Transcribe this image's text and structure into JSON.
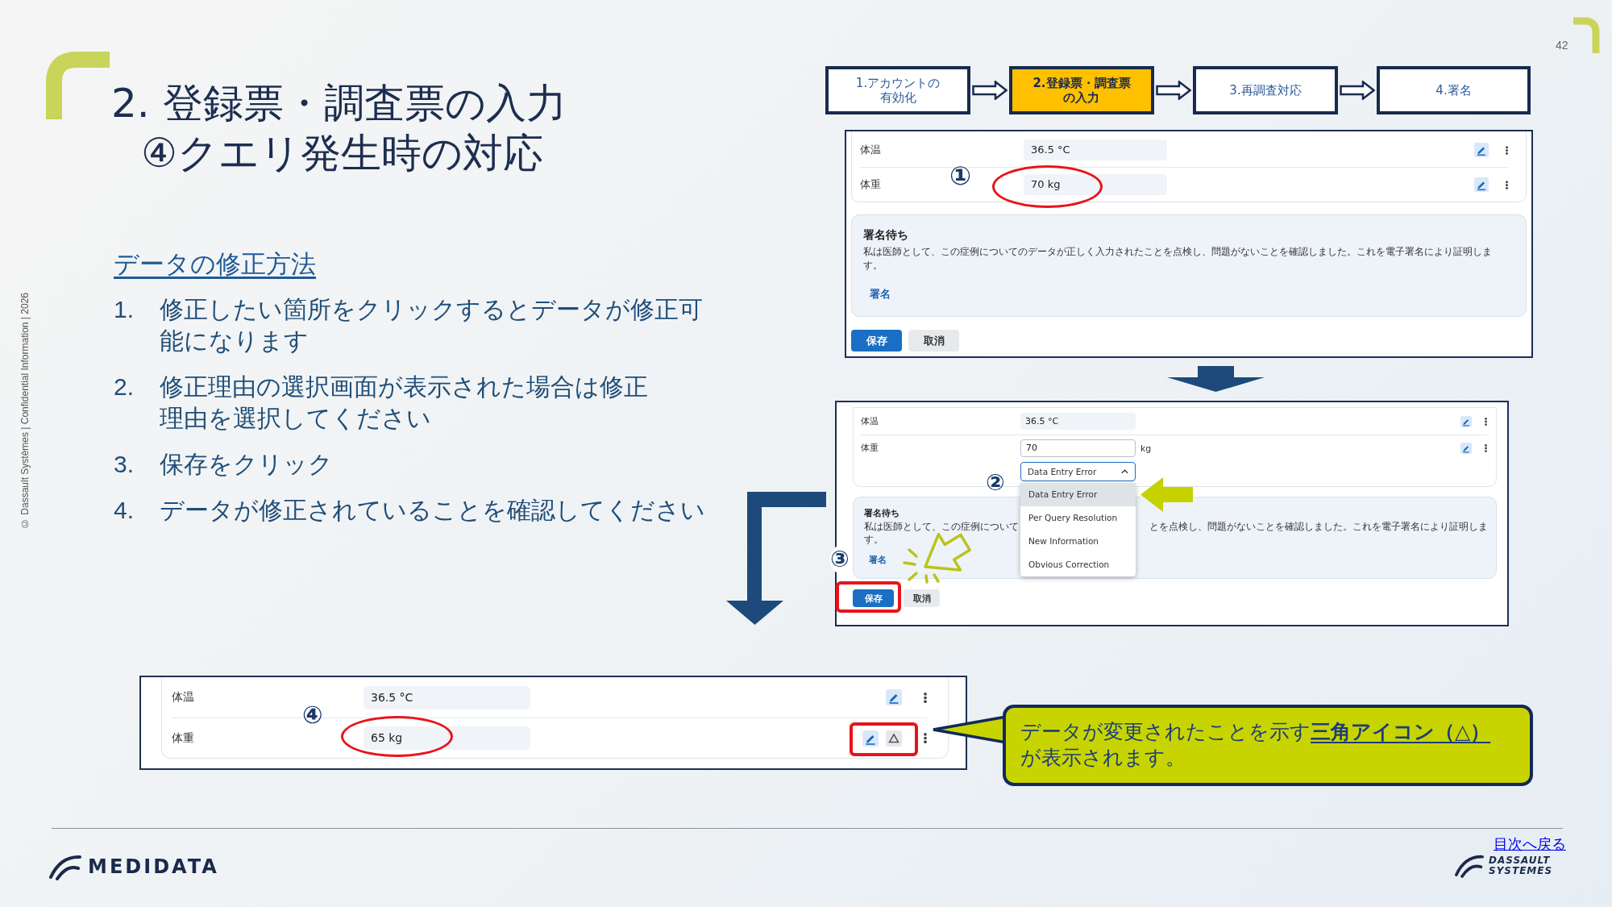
{
  "page_number": "42",
  "title": "2. 登録票・調査票の入力",
  "subtitle": "④クエリ発生時の対応",
  "side_note": "© Dassault Systèmes | Confidential Information | 2026",
  "flow_steps": [
    {
      "lines": [
        "1.アカウントの",
        "有効化"
      ],
      "selected": false
    },
    {
      "lines": [
        "2.登録票・調査票",
        "の入力"
      ],
      "selected": true
    },
    {
      "lines": [
        "3.再調査対応"
      ],
      "selected": false
    },
    {
      "lines": [
        "4.署名"
      ],
      "selected": false
    }
  ],
  "instructions": {
    "heading": "データの修正方法",
    "items": [
      {
        "number": "1.",
        "lines": [
          "修正したい箇所をクリックするとデータが修正可",
          "能になります"
        ]
      },
      {
        "number": "2.",
        "lines": [
          "修正理由の選択画面が表示された場合は修正",
          "理由を選択してください"
        ]
      },
      {
        "number": "3.",
        "lines": [
          "保存をクリック"
        ]
      },
      {
        "number": "4.",
        "lines": [
          "データが修正されていることを確認してください"
        ]
      }
    ]
  },
  "screenshot_before": {
    "marker": "①",
    "rows": [
      {
        "label": "体温",
        "value": "36.5 °C",
        "highlighted": false
      },
      {
        "label": "体重",
        "value": "70 kg",
        "highlighted": true
      }
    ],
    "signature": {
      "heading": "署名待ち",
      "text": "私は医師として、この症例についてのデータが正しく入力されたことを点検し、問題がないことを確認しました。これを電子署名により証明します。",
      "link": "署名"
    },
    "buttons": [
      {
        "label": "保存",
        "kind": "primary",
        "highlighted": false
      },
      {
        "label": "取消",
        "kind": "secondary",
        "highlighted": false
      }
    ]
  },
  "screenshot_editing": {
    "rows": [
      {
        "kind": "readonly",
        "label": "体温",
        "value": "36.5 °C"
      },
      {
        "kind": "editing",
        "label": "体重",
        "value": "70",
        "unit": "kg",
        "reason": {
          "value": "Data Entry Error",
          "expanded": true,
          "marker": "②",
          "options": [
            {
              "label": "Data Entry Error",
              "selected": true
            },
            {
              "label": "Per Query Resolution",
              "selected": false
            },
            {
              "label": "New Information",
              "selected": false
            },
            {
              "label": "Obvious Correction",
              "selected": false
            }
          ]
        }
      }
    ],
    "signature": {
      "heading": "署名待ち",
      "text_left": "私は医師として、この症例について",
      "text_right": "とを点検し、問題がないことを確認しました。これを電子署名により証明しま",
      "text_end": "す。",
      "link": "署名"
    },
    "save_marker": "③",
    "buttons": [
      {
        "label": "保存",
        "kind": "primary",
        "highlighted": true
      },
      {
        "label": "取消",
        "kind": "secondary",
        "highlighted": false
      }
    ]
  },
  "screenshot_after": {
    "marker": "④",
    "rows": [
      {
        "label": "体温",
        "value": "36.5 °C",
        "highlighted": false,
        "changed": false
      },
      {
        "label": "体重",
        "value": "65 kg",
        "highlighted": true,
        "changed": true
      }
    ]
  },
  "callout": {
    "lines": [
      "データが変更されたことを示す**三角アイコン（△）**",
      "が表示されます。"
    ]
  },
  "back_link": "目次へ戻る",
  "footer": {
    "brand_left": "MEDIDATA",
    "brand_right": [
      "DASSAULT",
      "SYSTEMES"
    ]
  }
}
